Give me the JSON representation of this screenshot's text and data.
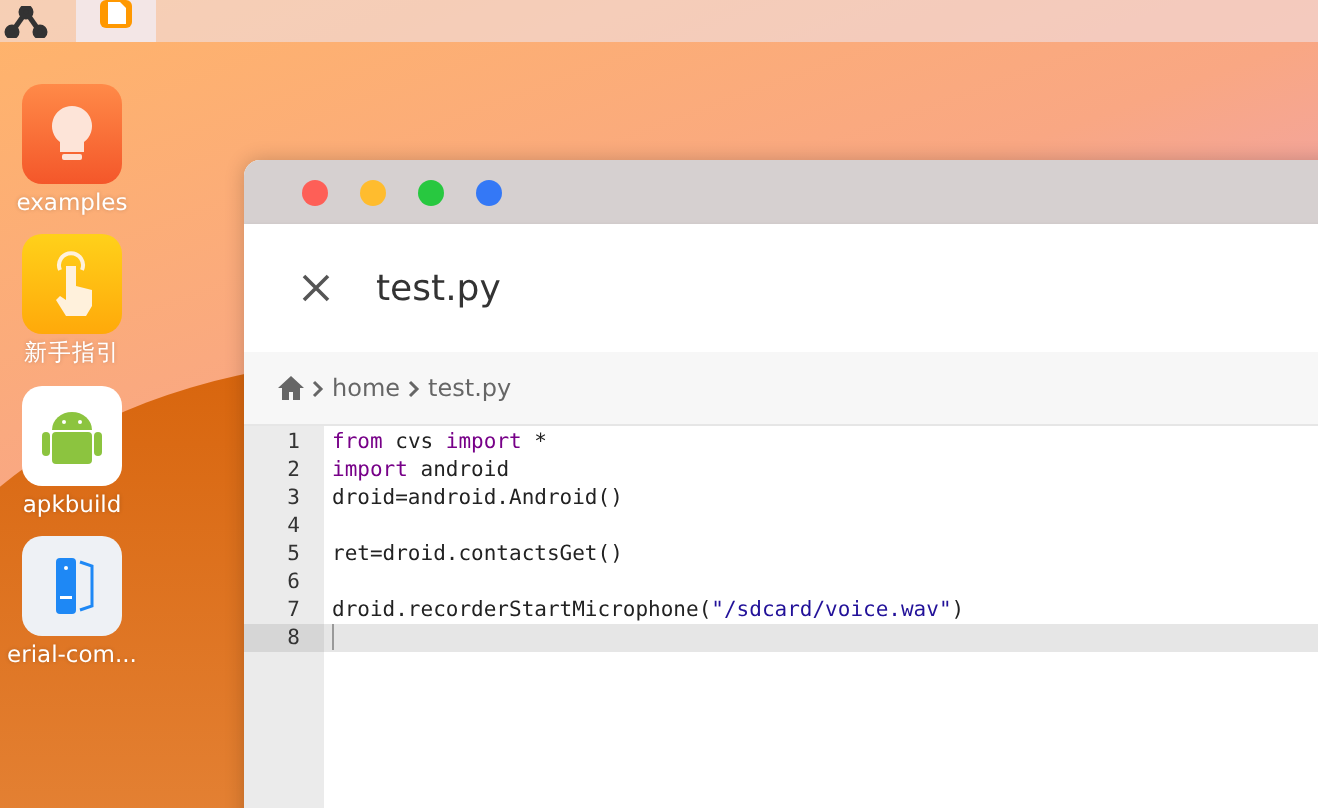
{
  "desktop": {
    "apps": [
      {
        "label": "examples",
        "kind": "bulb"
      },
      {
        "label": "新手指引",
        "kind": "hand"
      },
      {
        "label": "apkbuild",
        "kind": "android"
      },
      {
        "label": "erial-com...",
        "kind": "serial"
      }
    ]
  },
  "editor_window": {
    "traffic_lights": [
      {
        "color": "#fe5f57"
      },
      {
        "color": "#ffbc2e"
      },
      {
        "color": "#28c840"
      },
      {
        "color": "#3478f6"
      }
    ],
    "title": "test.py",
    "breadcrumb": [
      "home",
      "test.py"
    ],
    "lines": [
      {
        "number": "1",
        "selected": false,
        "tokens": [
          {
            "kind": "keyword",
            "text": "from"
          },
          {
            "kind": "plain",
            "text": " cvs "
          },
          {
            "kind": "keyword",
            "text": "import"
          },
          {
            "kind": "plain",
            "text": " *"
          }
        ]
      },
      {
        "number": "2",
        "selected": false,
        "tokens": [
          {
            "kind": "keyword",
            "text": "import"
          },
          {
            "kind": "plain",
            "text": " android"
          }
        ]
      },
      {
        "number": "3",
        "selected": false,
        "tokens": [
          {
            "kind": "plain",
            "text": "droid=android.Android()"
          }
        ]
      },
      {
        "number": "4",
        "selected": false
      },
      {
        "number": "5",
        "selected": false,
        "tokens": [
          {
            "kind": "plain",
            "text": "ret=droid.contactsGet()"
          }
        ]
      },
      {
        "number": "6",
        "selected": false
      },
      {
        "number": "7",
        "selected": false,
        "tokens": [
          {
            "kind": "plain",
            "text": "droid.recorderStartMicrophone("
          },
          {
            "kind": "string",
            "text": "\"/sdcard/voice.wav\""
          },
          {
            "kind": "plain",
            "text": ")"
          }
        ]
      },
      {
        "number": "8",
        "selected": true
      }
    ]
  }
}
